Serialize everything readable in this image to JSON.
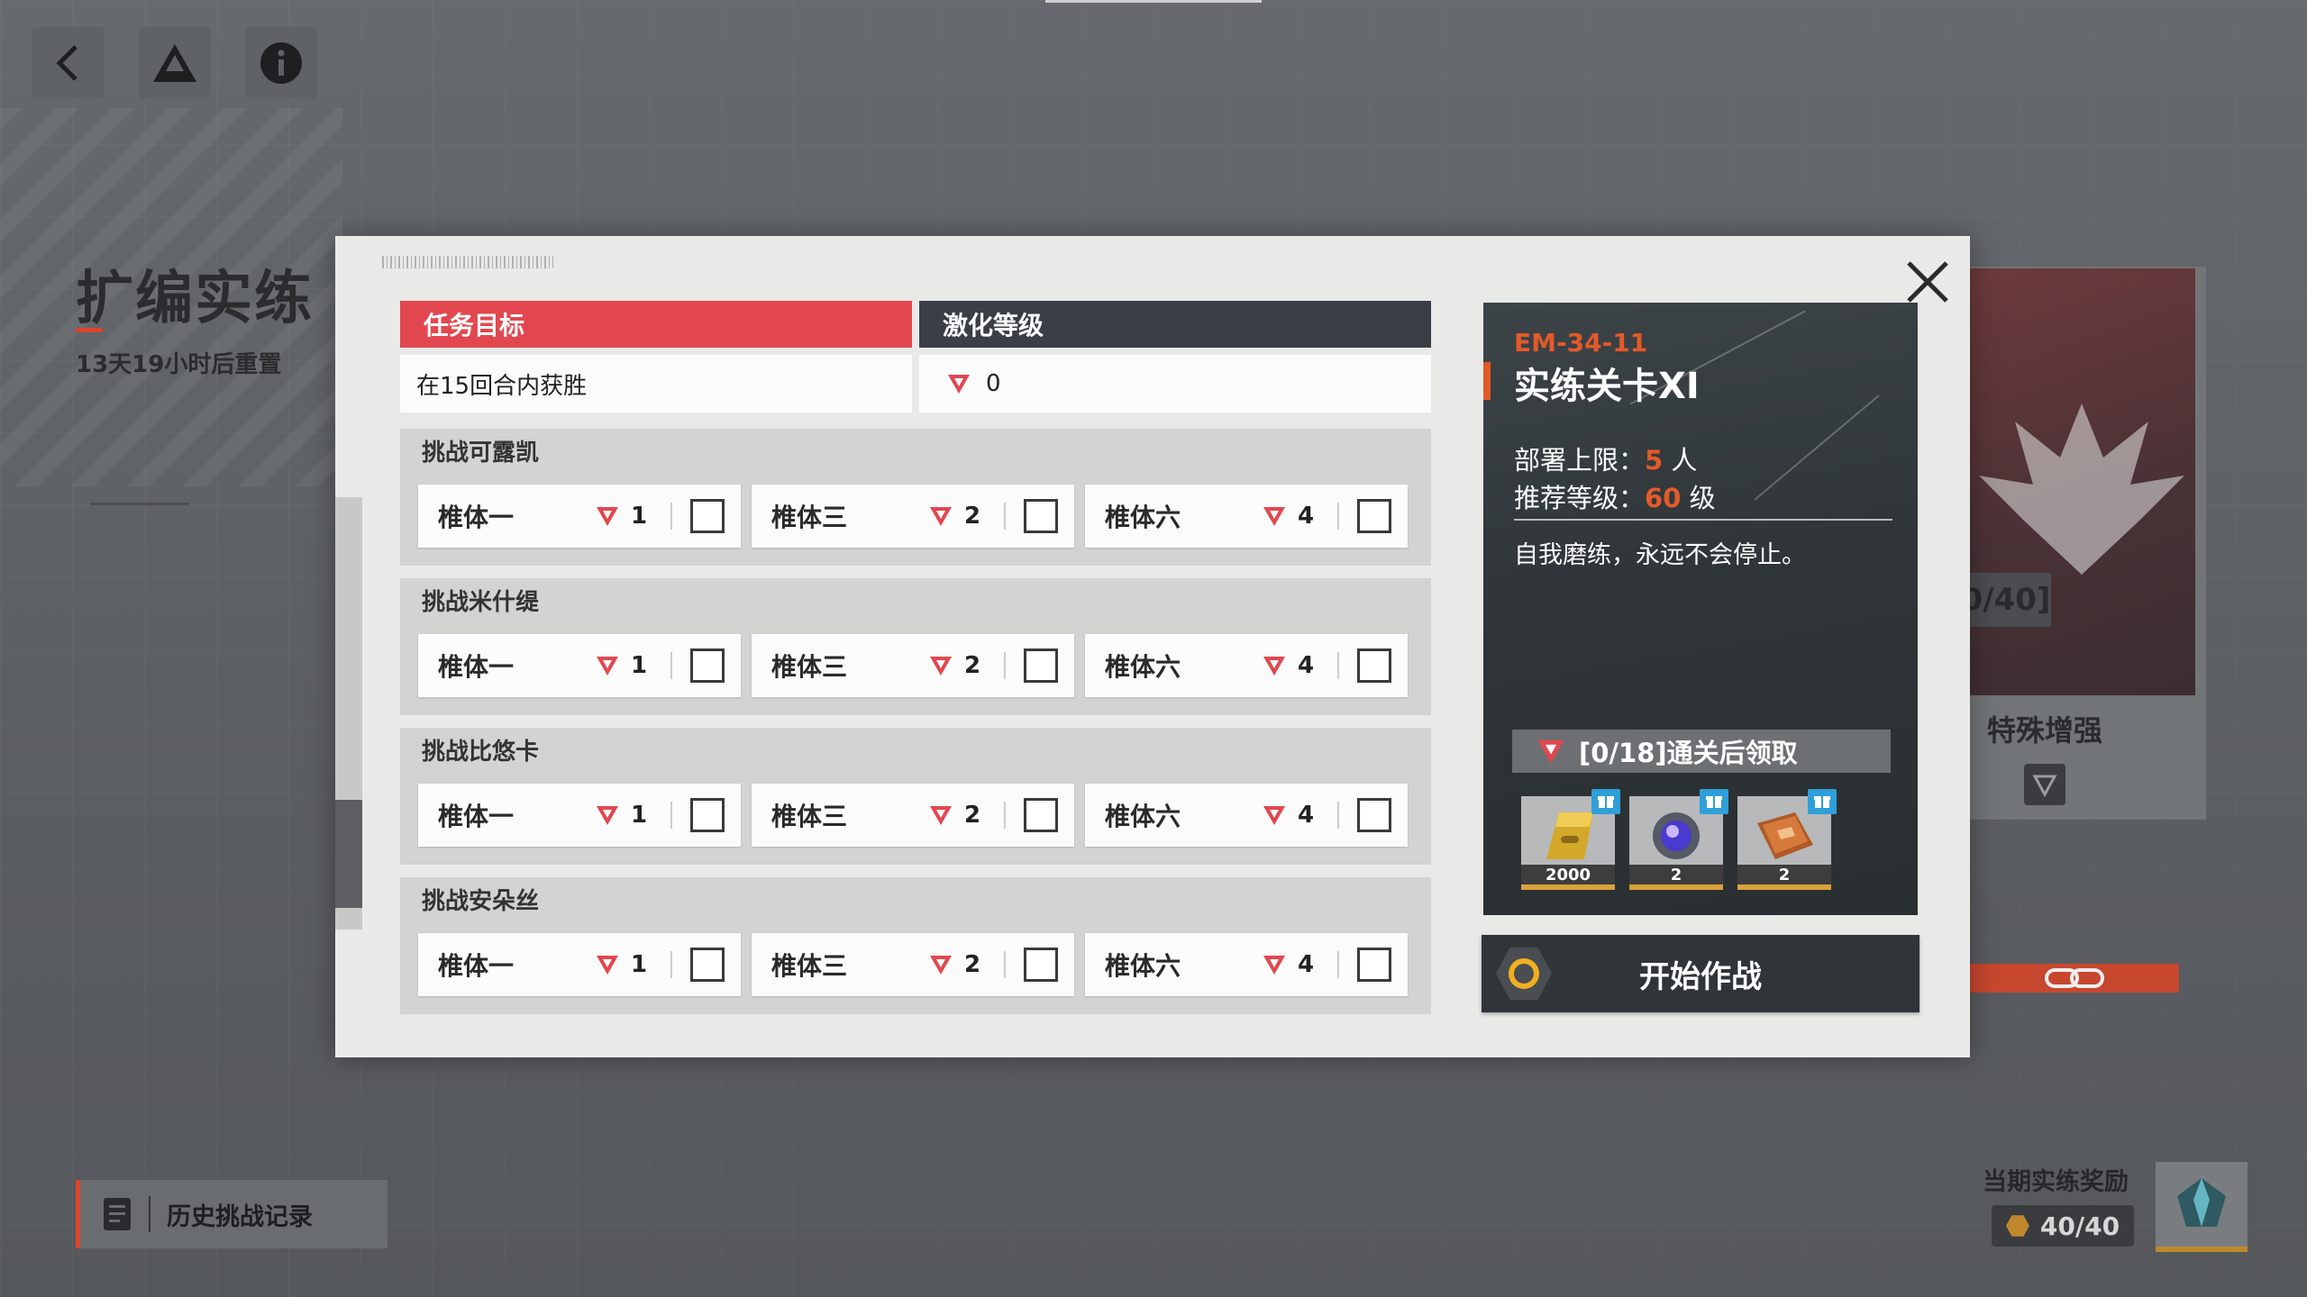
{
  "page": {
    "title": "扩编实练",
    "reset_text": "13天19小时后重置",
    "history_button": "历史挑战记录",
    "right_card_badge": "0/40]",
    "right_card_label": "特殊增强",
    "reward_title": "当期实练奖励",
    "reward_counter": "40/40"
  },
  "top_icons": [
    "back-arrow-icon",
    "triangle-logo-icon",
    "info-icon"
  ],
  "modal": {
    "task_header": "任务目标",
    "level_header": "激化等级",
    "goal_text": "在15回合内获胜",
    "goal_level": "0",
    "challenges": [
      {
        "title": "挑战可露凯",
        "cards": [
          {
            "name": "椎体一",
            "level": "1"
          },
          {
            "name": "椎体三",
            "level": "2"
          },
          {
            "name": "椎体六",
            "level": "4"
          }
        ]
      },
      {
        "title": "挑战米什缇",
        "cards": [
          {
            "name": "椎体一",
            "level": "1"
          },
          {
            "name": "椎体三",
            "level": "2"
          },
          {
            "name": "椎体六",
            "level": "4"
          }
        ]
      },
      {
        "title": "挑战比悠卡",
        "cards": [
          {
            "name": "椎体一",
            "level": "1"
          },
          {
            "name": "椎体三",
            "level": "2"
          },
          {
            "name": "椎体六",
            "level": "4"
          }
        ]
      },
      {
        "title": "挑战安朵丝",
        "cards": [
          {
            "name": "椎体一",
            "level": "1"
          },
          {
            "name": "椎体三",
            "level": "2"
          },
          {
            "name": "椎体六",
            "level": "4"
          }
        ]
      }
    ],
    "stage": {
      "code": "EM-34-11",
      "name": "实练关卡XI",
      "deploy_label": "部署上限：",
      "deploy_value": "5",
      "deploy_unit": " 人",
      "level_label": "推荐等级：",
      "level_value": "60",
      "level_unit": " 级",
      "description": "自我磨练，永远不会停止。",
      "reward_text": "[0/18]通关后领取",
      "rewards": [
        {
          "icon": "gold-bar-icon",
          "qty": "2000"
        },
        {
          "icon": "crystal-core-icon",
          "qty": "2"
        },
        {
          "icon": "data-book-icon",
          "qty": "2"
        }
      ]
    },
    "start_button": "开始作战"
  },
  "colors": {
    "accent_red": "#e2474f",
    "accent_orange": "#e35a2a",
    "dark_header": "#3a3f46",
    "gold": "#f0b020"
  }
}
